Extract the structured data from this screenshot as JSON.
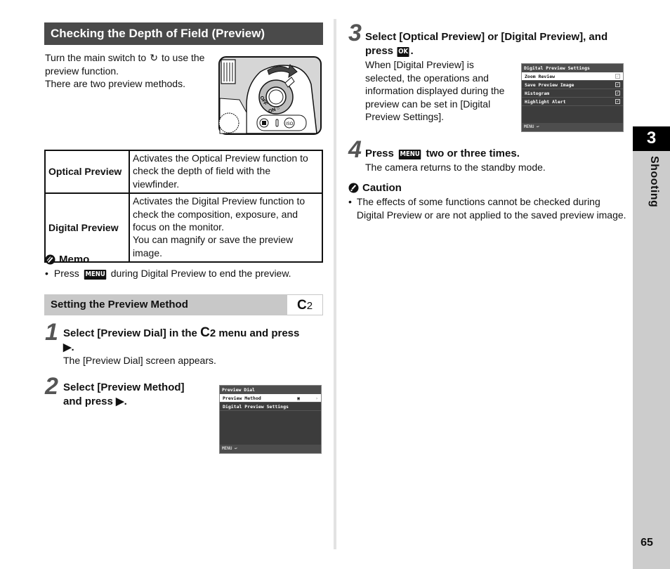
{
  "section1": {
    "title": "Checking the Depth of Field (Preview)",
    "intro_line1_before": "Turn the main switch to ",
    "intro_icon": "preview-switch-icon",
    "intro_line1_after": " to use the preview function.",
    "intro_line2": "There are two preview methods."
  },
  "camera_illustration": {
    "dial_labels": [
      "OFF",
      "ON",
      "○"
    ],
    "button_labels": [
      "◪",
      "ISO"
    ]
  },
  "preview_table": {
    "rows": [
      {
        "name": "Optical Preview",
        "description": [
          "Activates the Optical Preview function to check the depth of field with the viewfinder."
        ]
      },
      {
        "name": "Digital Preview",
        "description": [
          "Activates the Digital Preview function to check the composition, exposure, and focus on the monitor.",
          "You can magnify or save the preview image."
        ]
      }
    ]
  },
  "memo": {
    "title": "Memo",
    "bullet_before": "Press ",
    "key": "MENU",
    "bullet_after": " during Digital Preview to end the preview."
  },
  "section2": {
    "title": "Setting the Preview Method",
    "badge_letter": "C",
    "badge_number": "2"
  },
  "steps": [
    {
      "num": "1",
      "title_a": "Select [Preview Dial] in the ",
      "title_c": "C",
      "title_b": "2 menu and press",
      "title_arrow": "▶.",
      "text": "The [Preview Dial] screen appears."
    },
    {
      "num": "2",
      "title_line1": "Select [Preview Method]",
      "title_line2": "and press ▶."
    },
    {
      "num": "3",
      "title_line1": "Select [Optical Preview] or [Digital Preview], and",
      "title_line2_before": "press ",
      "key": "OK",
      "title_line2_after": ".",
      "text": "When [Digital Preview] is selected, the operations and information displayed during the preview can be set in [Digital Preview Settings]."
    },
    {
      "num": "4",
      "title_before": "Press ",
      "key": "MENU",
      "title_after": " two or three times.",
      "text": "The camera returns to the standby mode."
    }
  ],
  "screen_preview_dial": {
    "header": "Preview Dial",
    "rows": [
      {
        "label": "Preview Method",
        "value": "▣",
        "arrow": "›",
        "selected": true
      },
      {
        "label": "Digital Preview Settings",
        "value": "",
        "arrow": "",
        "selected": false
      }
    ],
    "footer": "MENU ↩"
  },
  "screen_digital_settings": {
    "header": "Digital Preview Settings",
    "rows": [
      {
        "label": "Zoom Review",
        "checked": true,
        "selected": true
      },
      {
        "label": "Save Preview Image",
        "checked": true,
        "selected": false
      },
      {
        "label": "Histogram",
        "checked": true,
        "selected": false
      },
      {
        "label": "Highlight Alert",
        "checked": true,
        "selected": false
      }
    ],
    "footer": "MENU ↩"
  },
  "caution": {
    "title": "Caution",
    "bullet": "The effects of some functions cannot be checked during Digital Preview or are not applied to the saved preview image."
  },
  "side_tab": {
    "chapter": "3",
    "label": "Shooting"
  },
  "page_number": "65"
}
